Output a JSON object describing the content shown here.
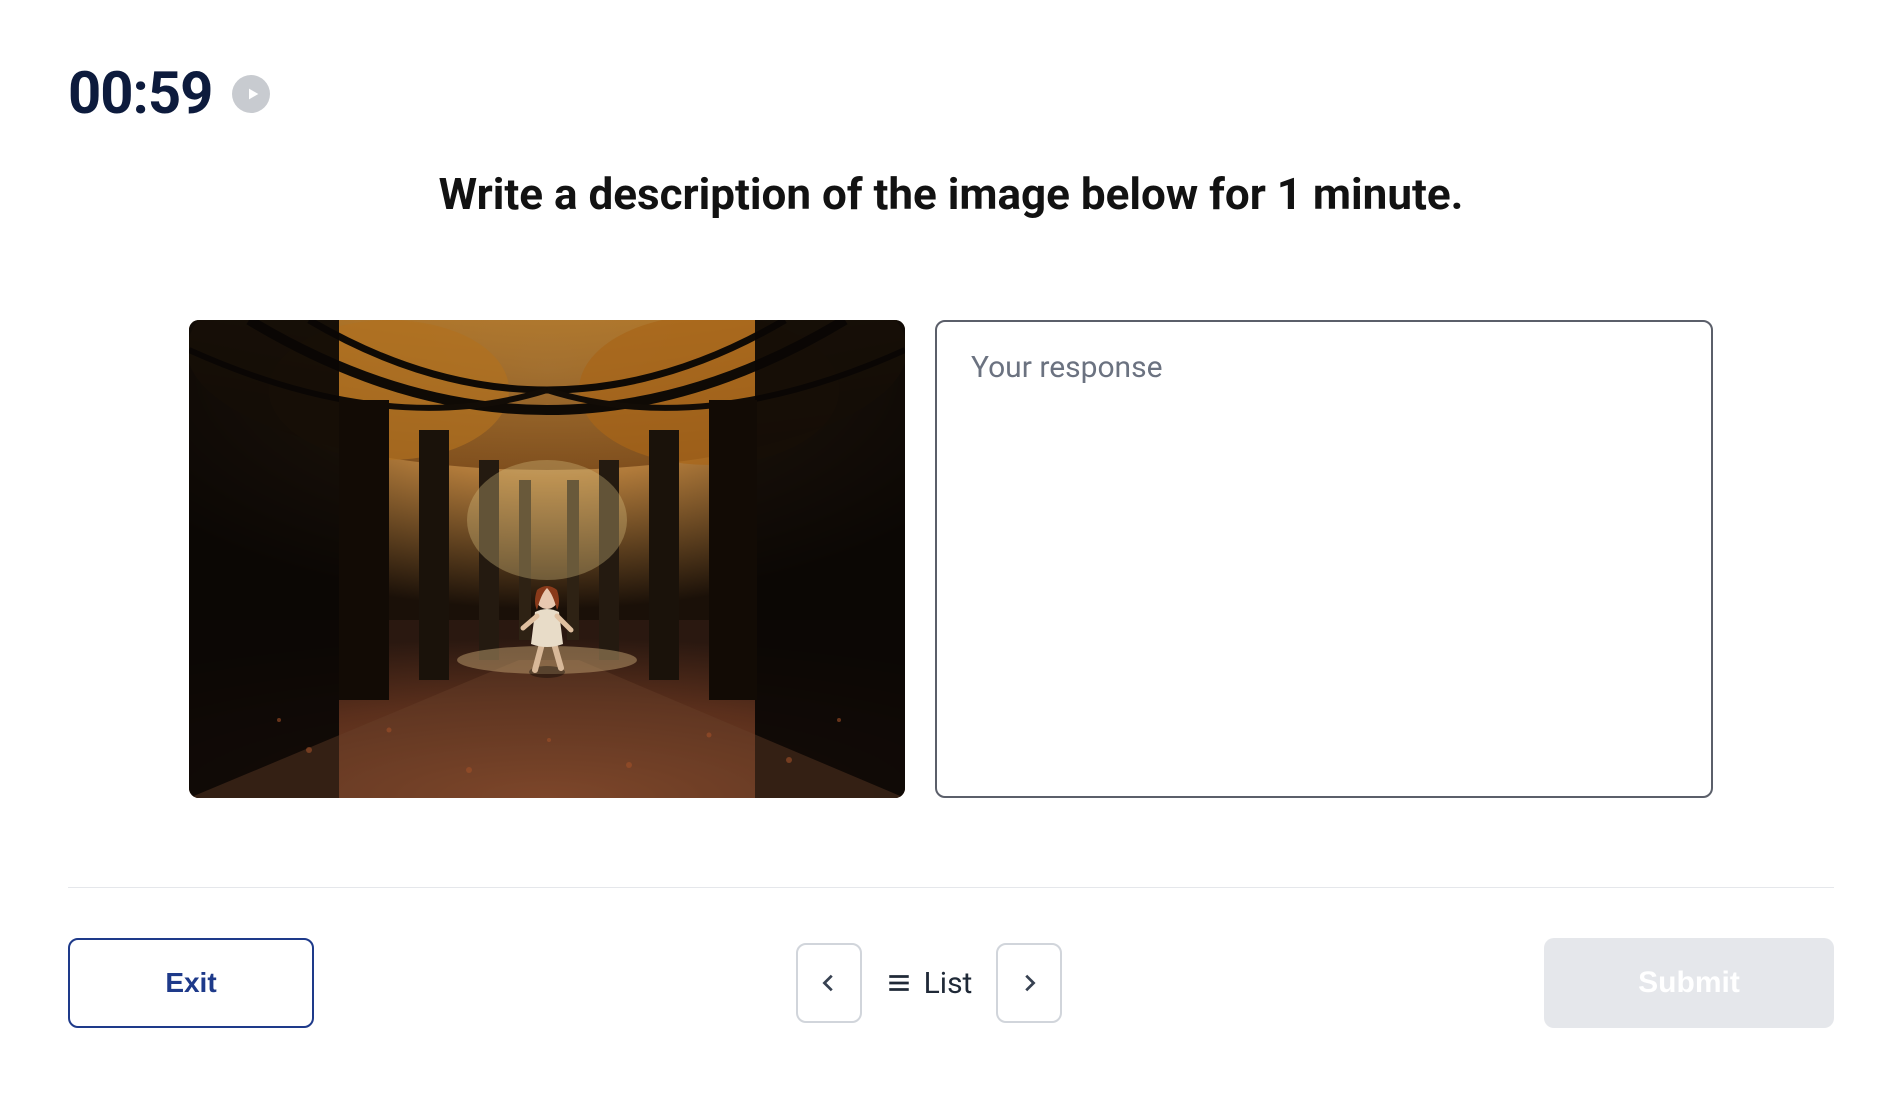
{
  "timer": {
    "display": "00:59"
  },
  "prompt": {
    "text": "Write a description of the image below for 1 minute."
  },
  "response": {
    "placeholder": "Your response",
    "value": ""
  },
  "footer": {
    "exit_label": "Exit",
    "list_label": "List",
    "submit_label": "Submit"
  },
  "icons": {
    "play": "play-icon",
    "chevron_left": "chevron-left-icon",
    "chevron_right": "chevron-right-icon",
    "list": "list-icon"
  },
  "image": {
    "description": "A child running toward the viewer along a path through an autumn forest with tall dark tree trunks and golden foliage overhead; fallen leaves cover the ground."
  }
}
